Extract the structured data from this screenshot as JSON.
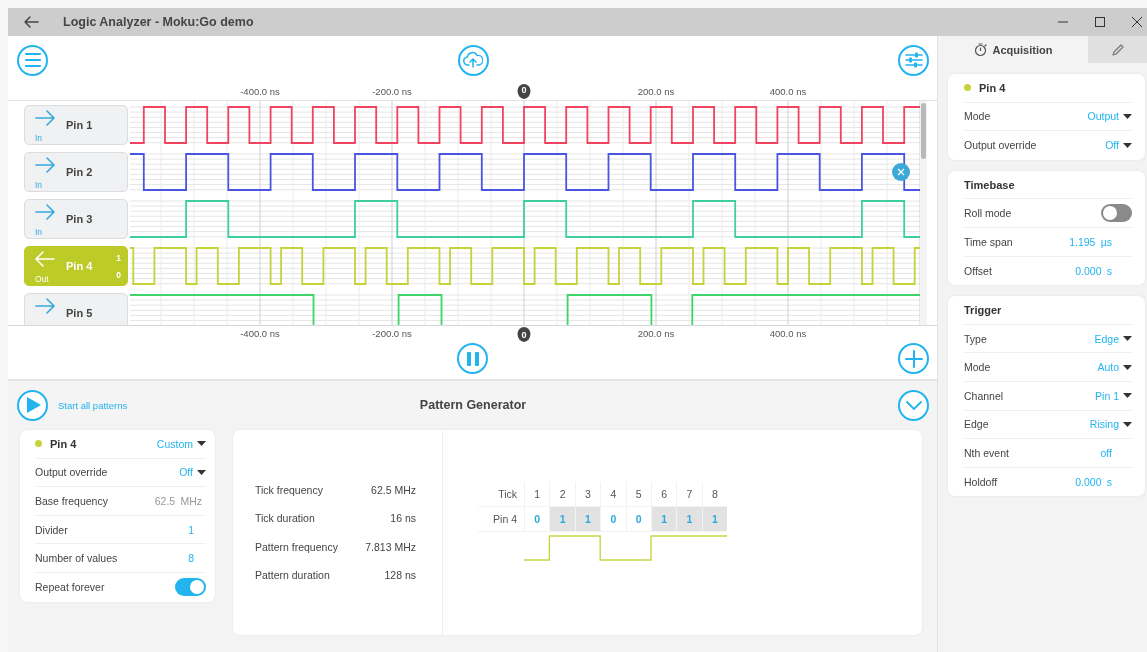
{
  "window": {
    "title": "Logic Analyzer - Moku:Go demo"
  },
  "time_axis": {
    "top_ticks": [
      {
        "label": "-400.0 ns",
        "kind": "tick"
      },
      {
        "label": "-200.0 ns",
        "kind": "tick"
      },
      {
        "label": "0",
        "kind": "marker"
      },
      {
        "label": "200.0 ns",
        "kind": "tick"
      },
      {
        "label": "400.0 ns",
        "kind": "tick"
      }
    ],
    "bottom_ticks": [
      {
        "label": "-400.0 ns",
        "kind": "tick"
      },
      {
        "label": "-200.0 ns",
        "kind": "tick"
      },
      {
        "label": "0",
        "kind": "marker"
      },
      {
        "label": "200.0 ns",
        "kind": "tick"
      },
      {
        "label": "400.0 ns",
        "kind": "tick"
      }
    ]
  },
  "channels": [
    {
      "name": "Pin 1",
      "kind": "input",
      "mode_label": "In",
      "color": "#f0435f",
      "selected": false
    },
    {
      "name": "Pin 2",
      "kind": "input",
      "mode_label": "In",
      "color": "#4a56e2",
      "selected": false
    },
    {
      "name": "Pin 3",
      "kind": "input",
      "mode_label": "In",
      "color": "#3fcf9e",
      "selected": false
    },
    {
      "name": "Pin 4",
      "kind": "output",
      "mode_label": "Out",
      "high_label": "1",
      "low_label": "0",
      "color": "#c5d238",
      "selected": true
    },
    {
      "name": "Pin 5",
      "kind": "input",
      "color": "#3ed46a",
      "selected": false
    }
  ],
  "pattern_generator": {
    "start_label": "Start all patterns",
    "title": "Pattern Generator",
    "pin_card": {
      "name": "Pin 4",
      "color": "#c5d238",
      "preset": "Custom",
      "rows": [
        {
          "label": "Output override",
          "kind": "dropdown",
          "value": "Off"
        },
        {
          "label": "Base frequency",
          "kind": "readonly",
          "value": "62.5",
          "unit": "MHz"
        },
        {
          "label": "Divider",
          "kind": "number",
          "value": "1"
        },
        {
          "label": "Number of values",
          "kind": "number",
          "value": "8"
        },
        {
          "label": "Repeat forever",
          "kind": "toggle",
          "on": true
        }
      ]
    },
    "stats": [
      {
        "label": "Tick frequency",
        "value": "62.5 MHz"
      },
      {
        "label": "Tick duration",
        "value": "16 ns"
      },
      {
        "label": "Pattern frequency",
        "value": "7.813 MHz"
      },
      {
        "label": "Pattern duration",
        "value": "128 ns"
      }
    ],
    "tick_table": {
      "header": "Tick",
      "ticks": [
        "1",
        "2",
        "3",
        "4",
        "5",
        "6",
        "7",
        "8"
      ],
      "row_label": "Pin 4",
      "values": [
        {
          "text": "0",
          "high": false
        },
        {
          "text": "1",
          "high": true
        },
        {
          "text": "1",
          "high": true
        },
        {
          "text": "0",
          "high": false
        },
        {
          "text": "0",
          "high": false
        },
        {
          "text": "1",
          "high": true
        },
        {
          "text": "1",
          "high": true
        },
        {
          "text": "1",
          "high": true
        }
      ]
    }
  },
  "side_panel": {
    "tabs": [
      {
        "label": "Acquisition",
        "kind": "acquisition",
        "selected": true
      },
      {
        "kind": "edit",
        "selected": false
      }
    ],
    "sections": [
      {
        "title": "Pin 4",
        "color": "#c5d238",
        "rows": [
          {
            "label": "Mode",
            "kind": "dropdown",
            "value": "Output"
          },
          {
            "label": "Output override",
            "kind": "dropdown",
            "value": "Off"
          }
        ]
      },
      {
        "title": "Timebase",
        "rows": [
          {
            "label": "Roll mode",
            "kind": "toggle",
            "on": false
          },
          {
            "label": "Time span",
            "kind": "number",
            "value": "1.195",
            "unit": "µs"
          },
          {
            "label": "Offset",
            "kind": "number",
            "value": "0.000",
            "unit": "s"
          }
        ]
      },
      {
        "title": "Trigger",
        "rows": [
          {
            "label": "Type",
            "kind": "dropdown",
            "value": "Edge"
          },
          {
            "label": "Mode",
            "kind": "dropdown",
            "value": "Auto"
          },
          {
            "label": "Channel",
            "kind": "dropdown",
            "value": "Pin 1"
          },
          {
            "label": "Edge",
            "kind": "dropdown",
            "value": "Rising"
          },
          {
            "label": "Nth event",
            "kind": "number",
            "value": "off"
          },
          {
            "label": "Holdoff",
            "kind": "number",
            "value": "0.000",
            "unit": "s"
          }
        ]
      }
    ]
  }
}
